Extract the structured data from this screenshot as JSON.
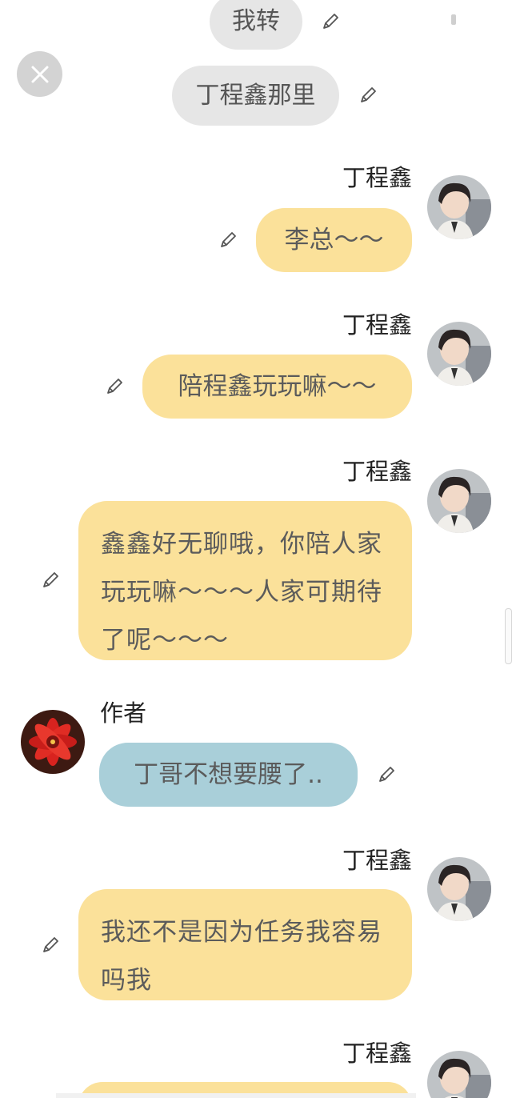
{
  "center_messages": [
    {
      "text": "我转"
    },
    {
      "text": "丁程鑫那里"
    }
  ],
  "messages": [
    {
      "sender": "丁程鑫",
      "text": "李总～～"
    },
    {
      "sender": "丁程鑫",
      "text": "陪程鑫玩玩嘛～～"
    },
    {
      "sender": "丁程鑫",
      "text": "鑫鑫好无聊哦，你陪人家玩玩嘛～～～人家可期待了呢～～～"
    },
    {
      "sender": "作者",
      "text": "丁哥不想要腰了.."
    },
    {
      "sender": "丁程鑫",
      "text": "我还不是因为任务我容易吗我"
    },
    {
      "sender": "丁程鑫",
      "text": ""
    }
  ],
  "icons": {
    "close": "close-icon",
    "edit": "pencil-icon",
    "avatar_character": "portrait-avatar",
    "avatar_author": "red-flower-avatar"
  },
  "colors": {
    "character_bubble": "#fbe19a",
    "author_bubble": "#a9cfd9",
    "narration_pill": "#e6e6e6",
    "close_button": "#d3d3d3",
    "text": "#5b5b5b"
  }
}
